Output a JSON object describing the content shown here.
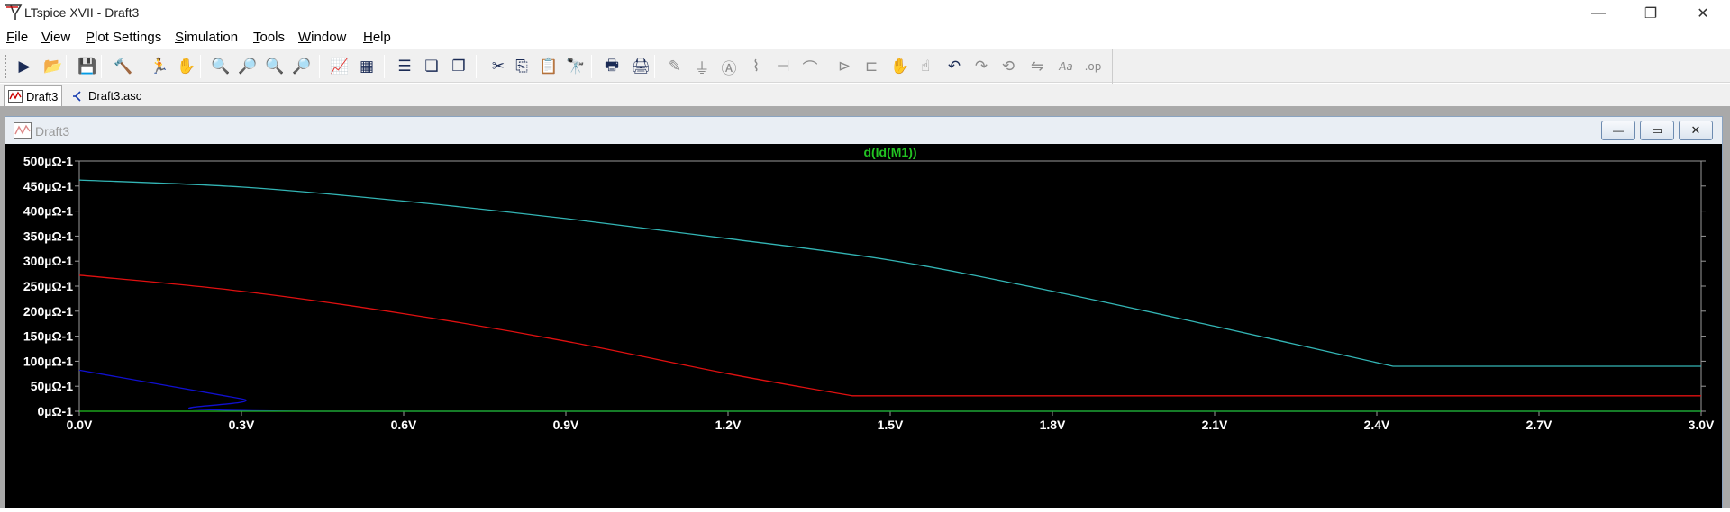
{
  "app": {
    "title": "LTspice XVII - Draft3",
    "window_controls": {
      "minimize": "—",
      "restore": "❐",
      "close": "✕"
    }
  },
  "menu": [
    {
      "label": "File"
    },
    {
      "label": "View"
    },
    {
      "label": "Plot Settings"
    },
    {
      "label": "Simulation"
    },
    {
      "label": "Tools"
    },
    {
      "label": "Window"
    },
    {
      "label": "Help"
    }
  ],
  "toolbar": {
    "icons": [
      "run-icon",
      "open-icon",
      "save-icon",
      "control-panel-icon",
      "halt-icon",
      "pan-icon",
      "zoom-in-icon",
      "zoom-area-icon",
      "zoom-out-icon",
      "zoom-fit-icon",
      "autorange-icon",
      "grid-icon",
      "tile-horizontal-icon",
      "cascade-icon",
      "tile-vertical-icon",
      "cut-icon",
      "copy-icon",
      "paste-icon",
      "find-icon",
      "print-icon",
      "print-setup-icon",
      "wire-icon",
      "ground-icon",
      "label-icon",
      "resistor-icon",
      "capacitor-icon",
      "inductor-icon",
      "diode-icon",
      "component-icon",
      "move-icon",
      "drag-icon",
      "undo-icon",
      "redo-icon",
      "rotate-icon",
      "mirror-icon",
      "text-icon",
      "spice-directive-icon"
    ]
  },
  "tabs": [
    {
      "label": "Draft3",
      "icon": "waveform-icon",
      "active": true
    },
    {
      "label": "Draft3.asc",
      "icon": "schematic-icon",
      "active": false
    }
  ],
  "plot_window": {
    "title": "Draft3",
    "controls": {
      "minimize": "—",
      "restore": "▭",
      "close": "✕"
    }
  },
  "colors": {
    "plot_bg": "#000000",
    "axis": "#9a9a9a",
    "trace_title": "#22c322"
  },
  "chart_data": {
    "type": "line",
    "title": "d(Id(M1))",
    "xlabel": "",
    "ylabel": "",
    "x_ticks": [
      "0.0V",
      "0.3V",
      "0.6V",
      "0.9V",
      "1.2V",
      "1.5V",
      "1.8V",
      "2.1V",
      "2.4V",
      "2.7V",
      "3.0V"
    ],
    "y_ticks": [
      "0µΩ-1",
      "50µΩ-1",
      "100µΩ-1",
      "150µΩ-1",
      "200µΩ-1",
      "250µΩ-1",
      "300µΩ-1",
      "350µΩ-1",
      "400µΩ-1",
      "450µΩ-1",
      "500µΩ-1"
    ],
    "xlim": [
      0,
      3.0
    ],
    "ylim": [
      0,
      500
    ],
    "grid": false,
    "series": [
      {
        "color": "#33b5b5",
        "x": [
          0,
          0.3,
          0.6,
          0.9,
          1.2,
          1.5,
          1.8,
          2.1,
          2.43,
          2.44,
          3.0
        ],
        "values": [
          462,
          448,
          420,
          385,
          345,
          302,
          240,
          170,
          90,
          90,
          90
        ]
      },
      {
        "color": "#e01010",
        "x": [
          0,
          0.3,
          0.6,
          0.9,
          1.2,
          1.43,
          1.44,
          3.0
        ],
        "values": [
          272,
          240,
          195,
          140,
          75,
          31,
          31,
          31
        ]
      },
      {
        "color": "#1010d0",
        "x": [
          0,
          0.3,
          0.42,
          3.0
        ],
        "values": [
          82,
          25,
          0,
          0
        ]
      },
      {
        "color": "#22c322",
        "x": [
          0,
          3.0
        ],
        "values": [
          0,
          0
        ]
      }
    ]
  }
}
